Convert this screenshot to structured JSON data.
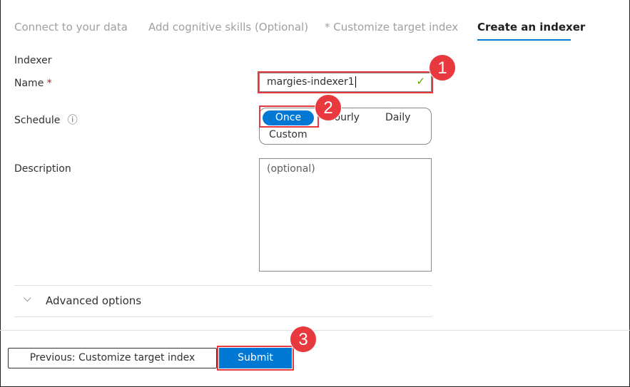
{
  "tabs": [
    {
      "label": "Connect to your data"
    },
    {
      "label": "Add cognitive skills (Optional)"
    },
    {
      "label": "* Customize target index"
    },
    {
      "label": "Create an indexer"
    }
  ],
  "section_title": "Indexer",
  "name": {
    "label": "Name",
    "required": "*",
    "value": "margies-indexer1"
  },
  "schedule": {
    "label": "Schedule",
    "info": "ⓘ",
    "options": [
      "Once",
      "Hourly",
      "Daily",
      "Custom"
    ],
    "selected": "Once"
  },
  "description": {
    "label": "Description",
    "placeholder": "(optional)"
  },
  "advanced": {
    "label": "Advanced options"
  },
  "buttons": {
    "previous": "Previous: Customize target index",
    "submit": "Submit"
  },
  "badges": [
    "1",
    "2",
    "3"
  ],
  "colors": {
    "accent": "#0078d4",
    "callout": "#e8393f",
    "valid": "#57a300"
  }
}
